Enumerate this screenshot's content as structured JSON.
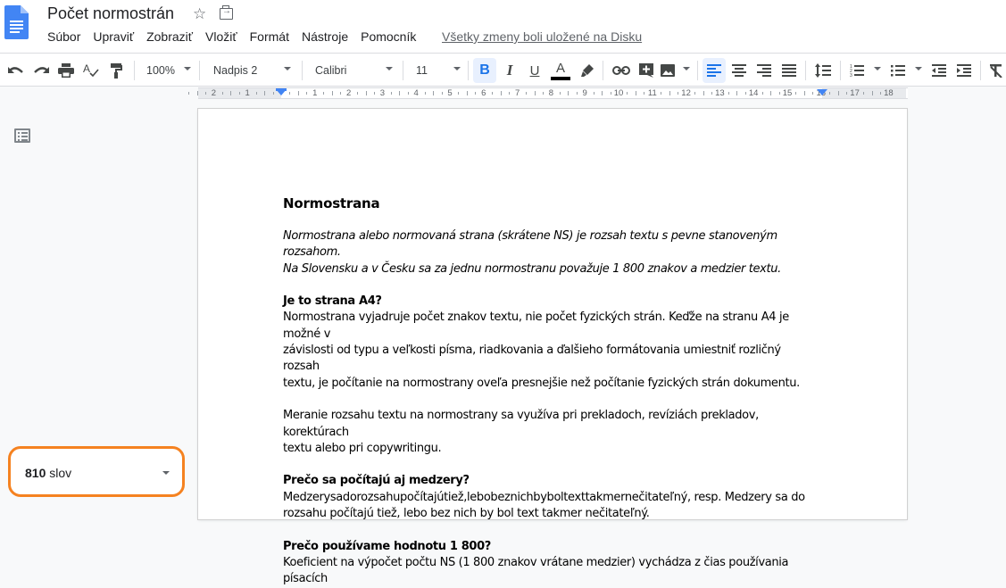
{
  "header": {
    "doc_title": "Počet normostrán",
    "saved_status": "Všetky zmeny boli uložené na Disku",
    "menu": [
      "Súbor",
      "Upraviť",
      "Zobraziť",
      "Vložiť",
      "Formát",
      "Nástroje",
      "Pomocník"
    ],
    "icons": {
      "logo": "google-docs-logo",
      "star": "star-icon",
      "move": "move-to-folder-icon"
    }
  },
  "toolbar": {
    "zoom": "100%",
    "style": "Nadpis 2",
    "font": "Calibri",
    "font_size": "11",
    "active": [
      "bold",
      "align-left"
    ],
    "text_color": "#000000",
    "accent": "#1a73e8"
  },
  "ruler": {
    "left_labels": [
      "2",
      "1"
    ],
    "right_labels": [
      "1",
      "2",
      "3",
      "4",
      "5",
      "6",
      "7",
      "8",
      "9",
      "10",
      "11",
      "12",
      "13",
      "14",
      "15",
      "16",
      "17",
      "18"
    ]
  },
  "sidebar": {
    "word_count": "810",
    "word_unit": "slov",
    "highlight_color": "#f58220"
  },
  "document": {
    "heading": "Normostrana",
    "intro_lines": [
      "Normostrana alebo normovaná strana (skrátene NS) je rozsah textu s pevne stanoveným rozsahom.",
      "Na Slovensku a v Česku sa za jednu normostranu považuje 1 800 znakov a medzier textu."
    ],
    "sections": [
      {
        "title": "Je to strana A4?",
        "lines": [
          "Normostrana vyjadruje počet znakov textu, nie počet fyzických strán. Keďže na stranu A4 je možné v",
          "závislosti od typu a veľkosti písma, riadkovania a ďalšieho formátovania umiestniť rozličný rozsah",
          "textu, je počítanie na normostrany oveľa presnejšie než počítanie fyzických strán dokumentu."
        ]
      },
      {
        "title": "",
        "lines": [
          "Meranie rozsahu textu na normostrany sa využíva pri prekladoch, revíziách prekladov, korektúrach",
          "textu alebo pri copywritingu."
        ]
      },
      {
        "title": "Prečo sa počítajú aj medzery?",
        "lines": [
          "Medzerysadorozsahupočítajútiež,lebobeznichbyboltexttakmernečitateľný, resp. Medzery sa do",
          "rozsahu počítajú tiež, lebo bez nich by bol text takmer nečitateľný."
        ]
      },
      {
        "title": "Prečo používame hodnotu 1 800?",
        "lines": [
          "Koeficient na výpočet počtu NS (1 800 znakov vrátane medzier) vychádza z čias používania písacích"
        ]
      }
    ]
  }
}
